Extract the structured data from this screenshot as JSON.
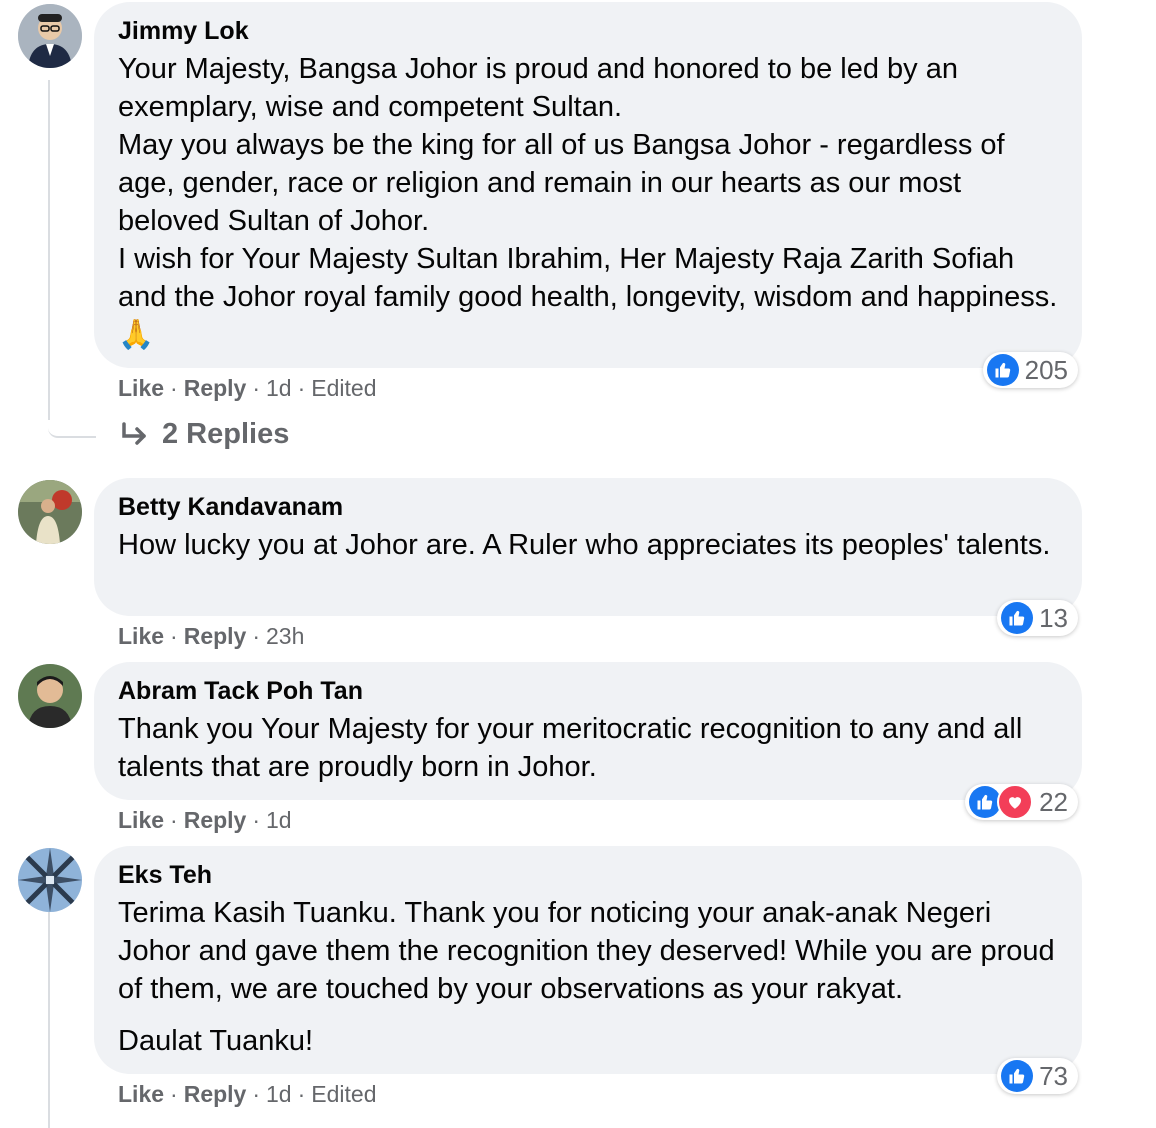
{
  "comments": [
    {
      "author": "Jimmy Lok",
      "paragraphs": [
        "Your Majesty, Bangsa Johor is proud and honored to be led by an exemplary, wise and competent Sultan.\nMay you always be the king for all of us Bangsa Johor - regardless of age, gender, race or religion and remain in our hearts as our most beloved Sultan of Johor.\nI wish for Your Majesty Sultan Ibrahim, Her Majesty Raja Zarith Sofiah and the Johor royal family good health, longevity, wisdom and happiness. 🙏"
      ],
      "like": "Like",
      "reply": "Reply",
      "time": "1d",
      "edited": "Edited",
      "reaction_count": "205",
      "reactions": [
        "like"
      ]
    },
    {
      "author": "Betty Kandavanam",
      "paragraphs": [
        "How lucky you at Johor are. A Ruler who appreciates its peoples' talents."
      ],
      "like": "Like",
      "reply": "Reply",
      "time": "23h",
      "reaction_count": "13",
      "reactions": [
        "like"
      ]
    },
    {
      "author": "Abram Tack Poh Tan",
      "paragraphs": [
        "Thank you Your Majesty for your meritocratic recognition to any and all talents that are proudly born in Johor."
      ],
      "like": "Like",
      "reply": "Reply",
      "time": "1d",
      "reaction_count": "22",
      "reactions": [
        "like",
        "love"
      ]
    },
    {
      "author": "Eks Teh",
      "paragraphs": [
        "Terima Kasih Tuanku. Thank you for noticing your anak-anak Negeri Johor and gave them the recognition they deserved! While you are proud of them, we are touched by your observations as your rakyat.",
        "Daulat Tuanku!"
      ],
      "like": "Like",
      "reply": "Reply",
      "time": "1d",
      "edited": "Edited",
      "reaction_count": "73",
      "reactions": [
        "like"
      ]
    }
  ],
  "replies_link": "2 Replies",
  "colors": {
    "bubble": "#f0f2f5",
    "secondary_text": "#65676b",
    "like_blue": "#1877f2",
    "love_red": "#f33e58"
  }
}
